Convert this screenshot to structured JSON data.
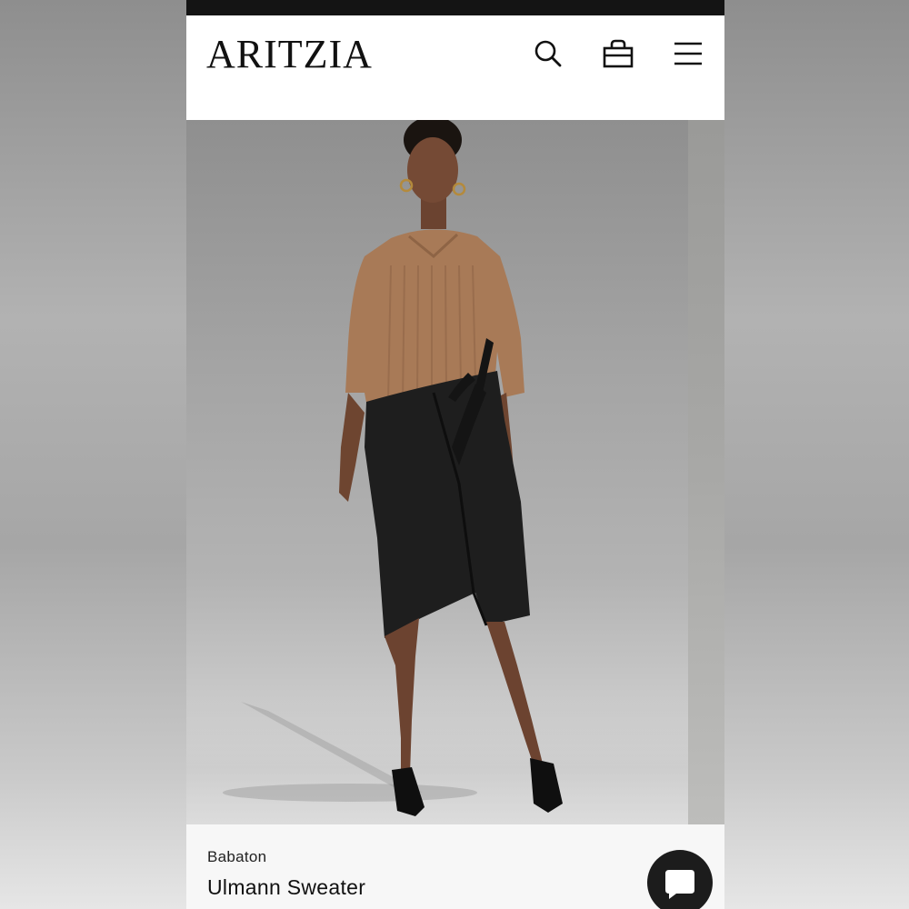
{
  "header": {
    "logo_text": "ARITZIA",
    "icons": [
      "search-icon",
      "bag-icon",
      "menu-icon"
    ]
  },
  "product": {
    "brand": "Babaton",
    "name": "Ulmann Sweater"
  },
  "colors": {
    "sweater": "#a87a57",
    "skirt": "#1e1e1e",
    "header_bg": "#ffffff",
    "chat_button": "#1c1c1c"
  }
}
